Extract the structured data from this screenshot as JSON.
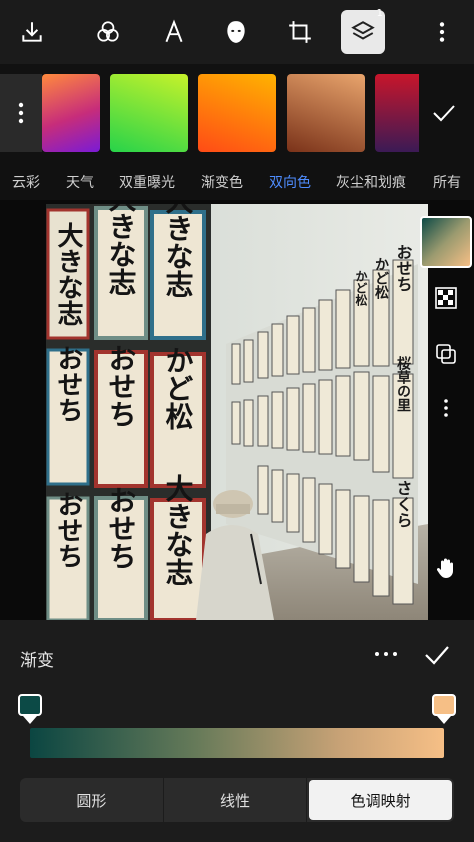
{
  "toolbar": {
    "icons": [
      "download-icon",
      "blend-circles-icon",
      "text-icon",
      "face-icon",
      "crop-icon",
      "layers-icon",
      "more-vertical-icon"
    ],
    "layers_badge": "1"
  },
  "presets": {
    "colors": {
      "tile1": [
        "#ff8a3d",
        "#8b1bd6"
      ],
      "tile2": [
        "#27d34a",
        "#c7f22a"
      ],
      "tile3": [
        "#ff4b16",
        "#ffb300"
      ],
      "tile4": [
        "#e9a56d",
        "#7a3219"
      ],
      "tile5": [
        "#c8162b",
        "#3b1a55"
      ]
    }
  },
  "categories": {
    "items": [
      "云彩",
      "天气",
      "双重曝光",
      "渐变色",
      "双向色",
      "灰尘和划痕",
      "所有"
    ],
    "active_index": 4
  },
  "photo": {
    "signs_left": [
      "大きな志",
      "大きな志",
      "大きな志",
      "おせち",
      "おせち",
      "かど松",
      "おせち",
      "おせち",
      "大きな志"
    ],
    "signs_right": [
      "おせち",
      "かど松",
      "かど松",
      "さくら",
      "桜草の里"
    ]
  },
  "panel": {
    "title": "渐变",
    "stop_left_color": "#0c4a46",
    "stop_right_color": "#f6bf86",
    "gradient_colors": [
      "#0b4642",
      "#667a59",
      "#c8a276",
      "#f6bf86"
    ],
    "segments": [
      "圆形",
      "线性",
      "色调映射"
    ],
    "active_segment": 2
  },
  "colors": {
    "accent_blue": "#4f8dff",
    "panel_bg": "#1c1c1c"
  }
}
